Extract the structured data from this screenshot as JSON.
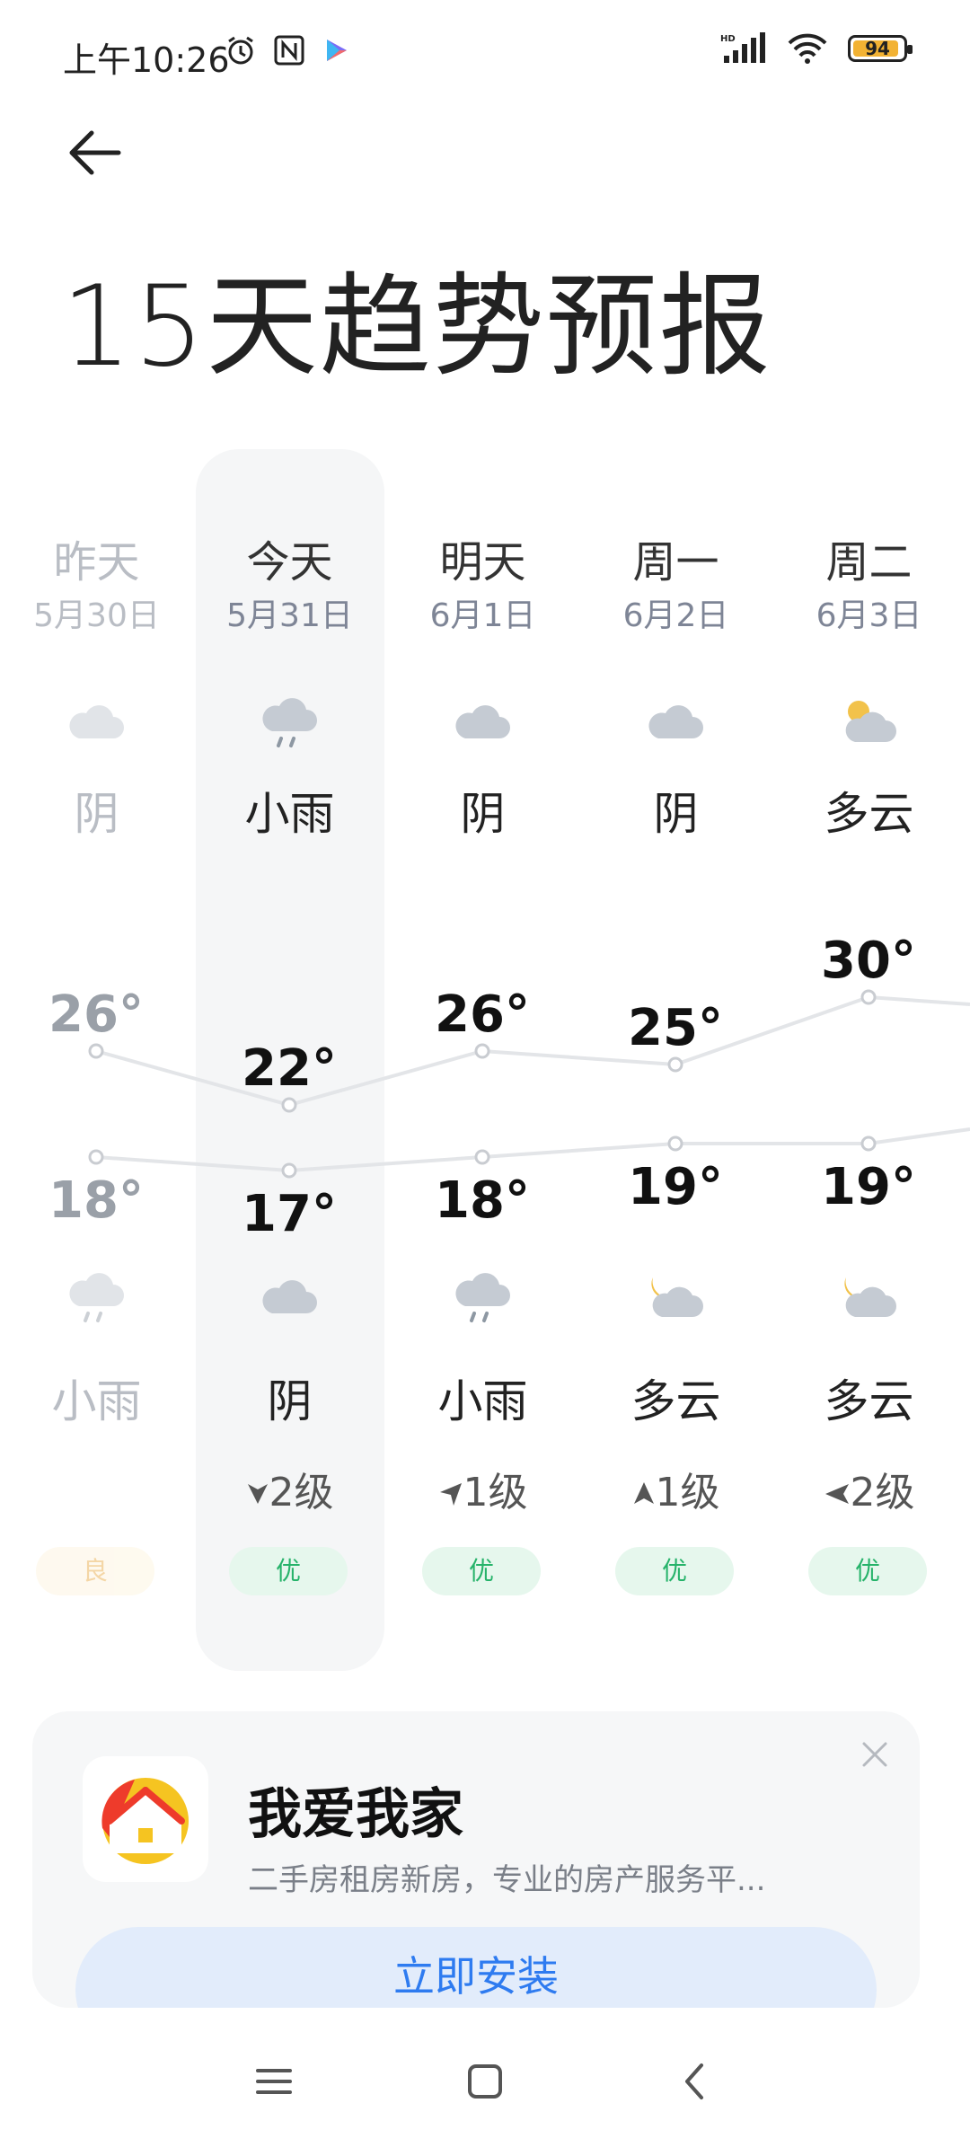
{
  "status_bar": {
    "time": "上午10:26",
    "battery": "94",
    "network": "HD"
  },
  "header": {
    "title": "15天趋势预报"
  },
  "forecast": {
    "days": [
      {
        "day": "昨天",
        "date": "5月30日",
        "day_condition": "阴",
        "day_icon": "cloud-icon",
        "high": "26°",
        "low": "18°",
        "night_condition": "小雨",
        "night_icon": "rain-cloud-icon",
        "wind": "",
        "aqi": "良"
      },
      {
        "day": "今天",
        "date": "5月31日",
        "day_condition": "小雨",
        "day_icon": "rain-cloud-icon",
        "high": "22°",
        "low": "17°",
        "night_condition": "阴",
        "night_icon": "cloud-icon",
        "wind": "2级",
        "aqi": "优"
      },
      {
        "day": "明天",
        "date": "6月1日",
        "day_condition": "阴",
        "day_icon": "cloud-icon",
        "high": "26°",
        "low": "18°",
        "night_condition": "小雨",
        "night_icon": "rain-cloud-icon",
        "wind": "1级",
        "aqi": "优"
      },
      {
        "day": "周一",
        "date": "6月2日",
        "day_condition": "阴",
        "day_icon": "cloud-icon",
        "high": "25°",
        "low": "19°",
        "night_condition": "多云",
        "night_icon": "moon-cloud-icon",
        "wind": "1级",
        "aqi": "优"
      },
      {
        "day": "周二",
        "date": "6月3日",
        "day_condition": "多云",
        "day_icon": "sun-cloud-icon",
        "high": "30°",
        "low": "19°",
        "night_condition": "多云",
        "night_icon": "moon-cloud-icon",
        "wind": "2级",
        "aqi": "优"
      }
    ]
  },
  "ad": {
    "app_name": "我爱我家",
    "description": "二手房租房新房，专业的房产服务平...",
    "install_label": "立即安装"
  },
  "colors": {
    "accent": "#2e7bf0",
    "aqi_good": "#26b36a",
    "aqi_fair": "#e8a63b",
    "highlight": "#f5f6f7"
  }
}
